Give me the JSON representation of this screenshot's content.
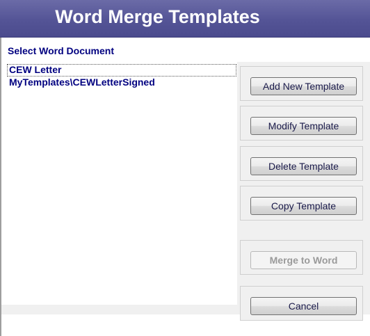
{
  "header": {
    "title": "Word Merge Templates"
  },
  "list": {
    "label": "Select Word Document",
    "items": [
      "CEW Letter",
      "MyTemplates\\CEWLetterSigned"
    ],
    "focused_index": 0
  },
  "buttons": {
    "add": "Add New Template",
    "modify": "Modify Template",
    "delete": "Delete Template",
    "copy": "Copy Template",
    "merge": "Merge to Word",
    "cancel": "Cancel"
  },
  "colors": {
    "title_bar": "#545496",
    "title_text": "#ffffff",
    "label_text": "#000080",
    "panel_bg": "#f0f0f0"
  }
}
